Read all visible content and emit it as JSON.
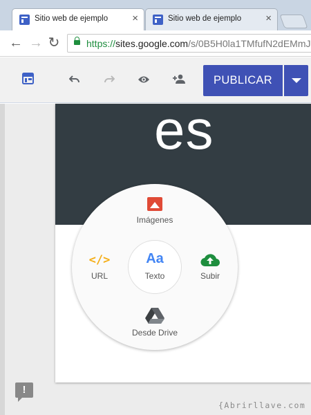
{
  "browser": {
    "tabs": [
      {
        "title": "Sitio web de ejemplo",
        "active": true
      },
      {
        "title": "Sitio web de ejemplo",
        "active": false
      }
    ],
    "close_glyph": "×",
    "url": {
      "scheme": "https://",
      "host": "sites.google.com",
      "path": "/s/0B5H0la1TMfufN2dEMmJ"
    },
    "nav": {
      "back": "←",
      "forward": "→",
      "reload": "↻"
    }
  },
  "editor": {
    "icons": [
      "site-layout-icon",
      "undo-icon",
      "redo-icon",
      "preview-eye-icon",
      "share-person-icon"
    ],
    "publish_label": "PUBLICAR",
    "accent": "#3f51b5"
  },
  "page": {
    "hero_text": "es",
    "hero_bg": "#333d43"
  },
  "insert_menu": {
    "images": "Imágenes",
    "url": "URL",
    "text_glyph": "Aa",
    "text": "Texto",
    "upload": "Subir",
    "drive": "Desde Drive"
  },
  "feedback_glyph": "!",
  "watermark": "{Abrirllave.com"
}
